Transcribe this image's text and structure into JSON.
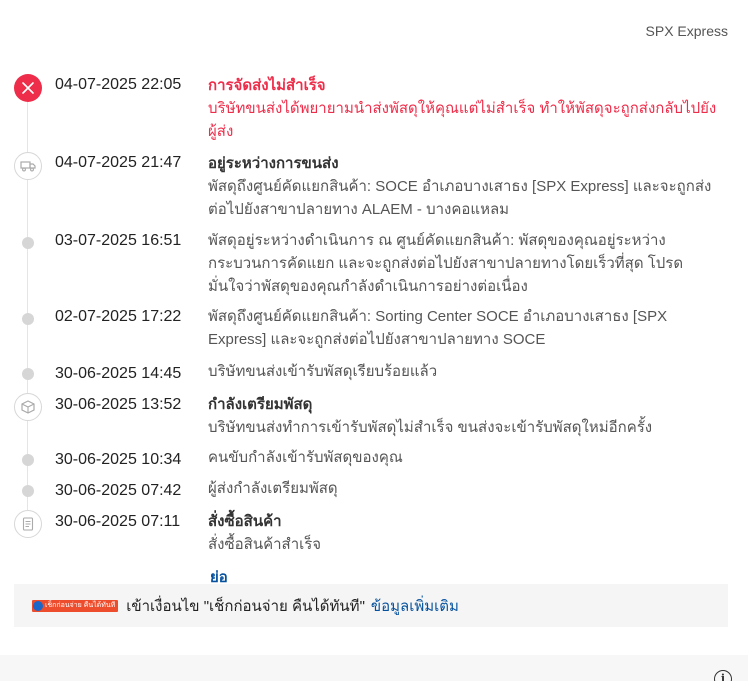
{
  "carrier": "SPX Express",
  "events": [
    {
      "time": "04-07-2025 22:05",
      "title": "การจัดส่งไม่สำเร็จ",
      "desc": "บริษัทขนส่งได้พยายามนำส่งพัสดุให้คุณแต่ไม่สำเร็จ ทำให้พัสดุจะถูกส่งกลับไปยังผู้ส่ง",
      "status_color": "#ee2d4a",
      "icon": "close-icon"
    },
    {
      "time": "04-07-2025 21:47",
      "title": "อยู่ระหว่างการขนส่ง",
      "desc": "พัสดุถึงศูนย์คัดแยกสินค้า: SOCE อำเภอบางเสาธง [SPX Express] และจะถูกส่งต่อไปยังสาขาปลายทาง ALAEM - บางคอแหลม",
      "icon": "truck-icon"
    },
    {
      "time": "03-07-2025 16:51",
      "title": "",
      "desc": "พัสดุอยู่ระหว่างดำเนินการ ณ ศูนย์คัดแยกสินค้า: พัสดุของคุณอยู่ระหว่างกระบวนการคัดแยก และจะถูกส่งต่อไปยังสาขาปลายทางโดยเร็วที่สุด โปรดมั่นใจว่าพัสดุของคุณกำลังดำเนินการอย่างต่อเนื่อง",
      "icon": "dot"
    },
    {
      "time": "02-07-2025 17:22",
      "title": "",
      "desc": "พัสดุถึงศูนย์คัดแยกสินค้า: Sorting Center SOCE อำเภอบางเสาธง [SPX Express] และจะถูกส่งต่อไปยังสาขาปลายทาง SOCE",
      "icon": "dot"
    },
    {
      "time": "30-06-2025 14:45",
      "title": "",
      "desc": "บริษัทขนส่งเข้ารับพัสดุเรียบร้อยแล้ว",
      "icon": "dot"
    },
    {
      "time": "30-06-2025 13:52",
      "title": "กำลังเตรียมพัสดุ",
      "desc": "บริษัทขนส่งทำการเข้ารับพัสดุไม่สำเร็จ ขนส่งจะเข้ารับพัสดุใหม่อีกครั้ง",
      "icon": "package-icon"
    },
    {
      "time": "30-06-2025 10:34",
      "title": "",
      "desc": "คนขับกำลังเข้ารับพัสดุของคุณ",
      "icon": "dot"
    },
    {
      "time": "30-06-2025 07:42",
      "title": "",
      "desc": "ผู้ส่งกำลังเตรียมพัสดุ",
      "icon": "dot"
    },
    {
      "time": "30-06-2025 07:11",
      "title": "สั่งซื้อสินค้า",
      "desc": "สั่งซื้อสินค้าสำเร็จ",
      "icon": "receipt-icon"
    }
  ],
  "collapse_label": "ย่อ",
  "banner": {
    "badge": "เช็กก่อนจ่าย คืนได้ทันที",
    "text": "เข้าเงื่อนไข \"เช็กก่อนจ่าย คืนได้ทันที\"",
    "link": "ข้อมูลเพิ่มเติม"
  },
  "info_glyph": "i"
}
